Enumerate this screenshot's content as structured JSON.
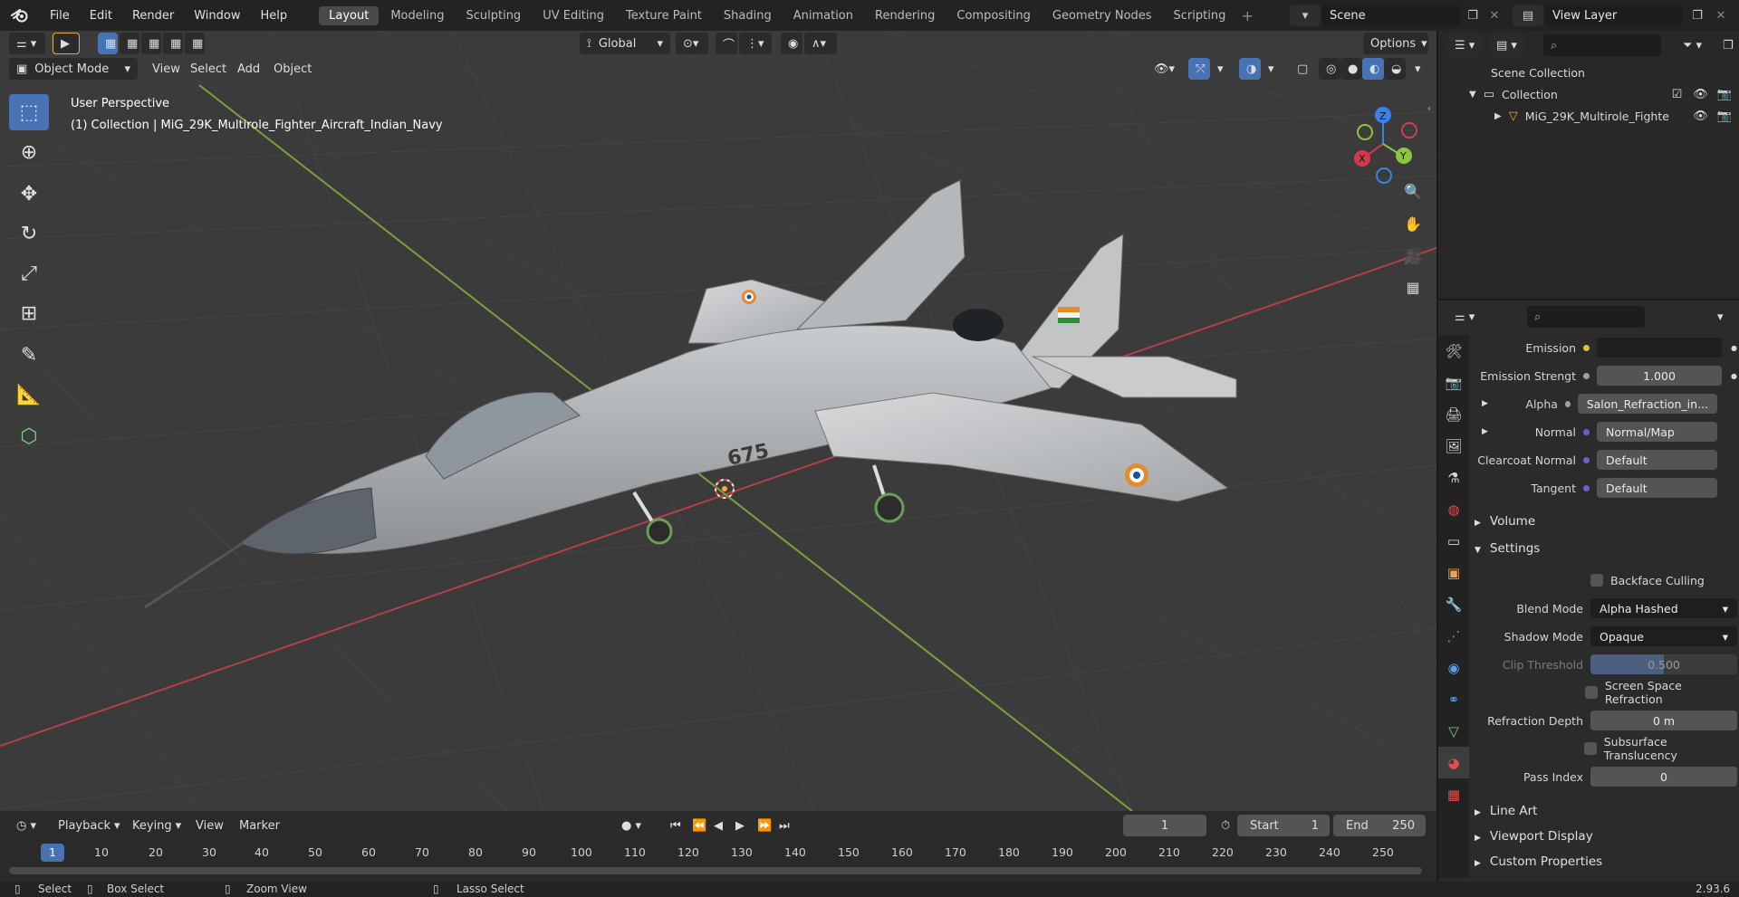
{
  "topbar": {
    "menus": [
      "File",
      "Edit",
      "Render",
      "Window",
      "Help"
    ],
    "workspaces": [
      "Layout",
      "Modeling",
      "Sculpting",
      "UV Editing",
      "Texture Paint",
      "Shading",
      "Animation",
      "Rendering",
      "Compositing",
      "Geometry Nodes",
      "Scripting"
    ],
    "active_workspace": "Layout",
    "scene_name": "Scene",
    "view_layer": "View Layer"
  },
  "viewport": {
    "transform_orientation": "Global",
    "options_label": "Options",
    "mode": "Object Mode",
    "header_menus": [
      "View",
      "Select",
      "Add",
      "Object"
    ],
    "overlay_title": "User Perspective",
    "overlay_collection": "(1) Collection | MiG_29K_Multirole_Fighter_Aircraft_Indian_Navy",
    "aircraft_number": "675",
    "gizmo": {
      "x": "X",
      "y": "Y",
      "z": "Z"
    }
  },
  "timeline": {
    "menus": [
      "Playback",
      "Keying",
      "View",
      "Marker"
    ],
    "current_frame": "1",
    "start_label": "Start",
    "start_value": "1",
    "end_label": "End",
    "end_value": "250",
    "ruler": [
      "1",
      "10",
      "20",
      "30",
      "40",
      "50",
      "60",
      "70",
      "80",
      "90",
      "100",
      "110",
      "120",
      "130",
      "140",
      "150",
      "160",
      "170",
      "180",
      "190",
      "200",
      "210",
      "220",
      "230",
      "240",
      "250"
    ]
  },
  "status": {
    "select": "Select",
    "box_select": "Box Select",
    "zoom_view": "Zoom View",
    "lasso_select": "Lasso Select",
    "version": "2.93.6"
  },
  "outliner": {
    "scene_collection": "Scene Collection",
    "collection": "Collection",
    "object": "MiG_29K_Multirole_Fighte"
  },
  "properties": {
    "rows": {
      "emission": {
        "label": "Emission",
        "value": ""
      },
      "emission_strength": {
        "label": "Emission Strengt",
        "value": "1.000"
      },
      "alpha": {
        "label": "Alpha",
        "value": "Salon_Refraction_in..."
      },
      "normal": {
        "label": "Normal",
        "value": "Normal/Map"
      },
      "clearcoat_normal": {
        "label": "Clearcoat Normal",
        "value": "Default"
      },
      "tangent": {
        "label": "Tangent",
        "value": "Default"
      }
    },
    "sections": {
      "volume": "Volume",
      "settings": "Settings",
      "line_art": "Line Art",
      "viewport_display": "Viewport Display",
      "custom_properties": "Custom Properties"
    },
    "settings": {
      "backface_culling": "Backface Culling",
      "blend_mode_label": "Blend Mode",
      "blend_mode_value": "Alpha Hashed",
      "shadow_mode_label": "Shadow Mode",
      "shadow_mode_value": "Opaque",
      "clip_threshold_label": "Clip Threshold",
      "clip_threshold_value": "0.500",
      "screen_space_refraction": "Screen Space Refraction",
      "refraction_depth_label": "Refraction Depth",
      "refraction_depth_value": "0 m",
      "subsurface_translucency": "Subsurface Translucency",
      "pass_index_label": "Pass Index",
      "pass_index_value": "0"
    }
  },
  "colors": {
    "accent": "#4772b3",
    "x_axis": "#d13b4d",
    "y_axis": "#8cc540",
    "z_axis": "#3a82e8"
  }
}
